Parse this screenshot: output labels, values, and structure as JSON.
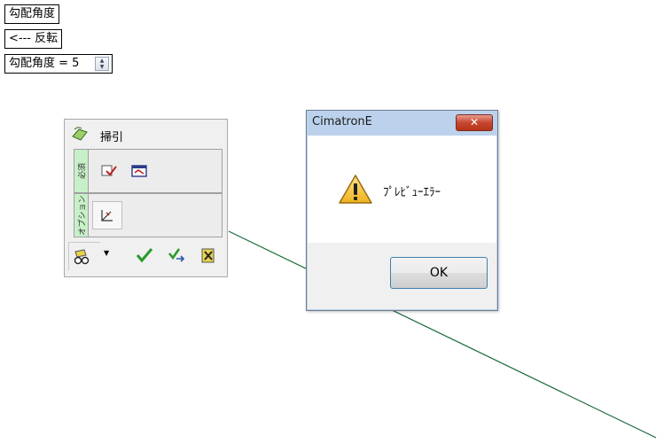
{
  "labels": {
    "angle_label": "勾配角度",
    "reverse_label": "<--- 反転",
    "angle_value": "勾配角度 = 5"
  },
  "panel": {
    "title": "掃引",
    "group1_tab": "必須",
    "group2_tab": "オプション"
  },
  "dialog": {
    "title": "CimatronE",
    "message": "ﾌﾟﾚﾋﾞｭｰｴﾗｰ",
    "ok_label": "OK",
    "close_glyph": "✕"
  },
  "colors": {
    "curve": "#1a6b3a",
    "tab_green": "#c8f0c8",
    "close_red": "#c7462f",
    "ok_border": "#3c7fb1"
  }
}
